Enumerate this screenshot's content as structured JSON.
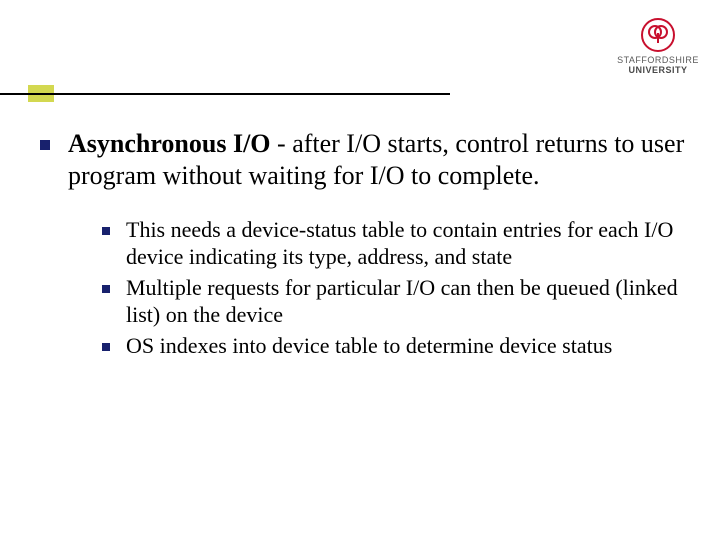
{
  "logo": {
    "line1": "STAFFORDSHIRE",
    "line2": "UNIVERSITY"
  },
  "main": {
    "lead": "Asynchronous I/O",
    "rest": " - after I/O starts, control returns to user program without waiting for I/O to complete."
  },
  "subitems": [
    "This needs a device-status table to contain entries for each I/O device indicating its type, address, and state",
    "Multiple requests for particular I/O can then be queued (linked list) on the device",
    "OS indexes into device table to determine device status"
  ]
}
